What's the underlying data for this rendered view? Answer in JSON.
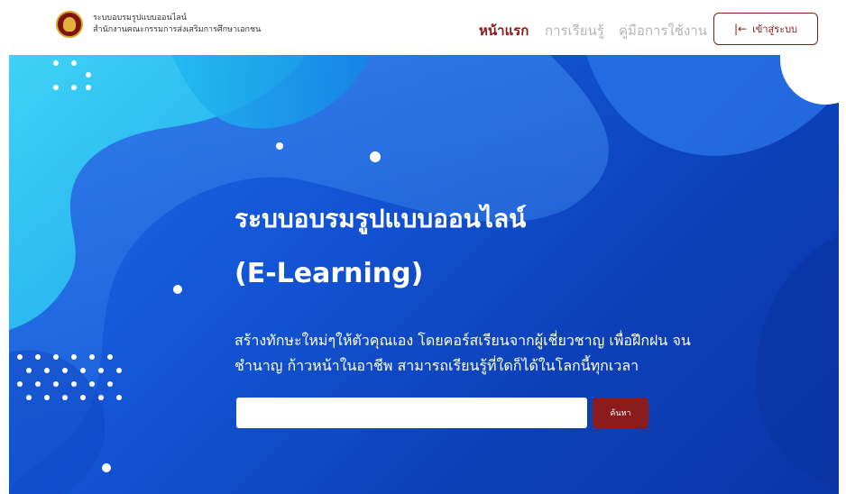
{
  "brand": {
    "title": "ระบบอบรมรูปแบบออนไลน์",
    "subtitle": "สำนักงานคณะกรรมการส่งเสริมการศึกษาเอกชน",
    "logo_icon": "seal-emblem-icon"
  },
  "nav": {
    "home": "หน้าแรก",
    "learn": "การเรียนรู้",
    "manual": "คู่มือการใช้งาน",
    "login_label": "เข้าสู่ระบบ",
    "login_icon": "login-arrow-icon"
  },
  "hero": {
    "title_line1": "ระบบอบรมรูปแบบออนไลน์",
    "title_line2": "(E-Learning)",
    "description": "สร้างทักษะใหม่ๆให้ตัวคุณเอง โดยคอร์สเรียนจากผู้เชี่ยวชาญ เพื่อฝึกฝน จนชำนาญ ก้าวหน้าในอาชีพ สามารถเรียนรู้ที่ใดก็ได้ในโลกนี้ทุกเวลา"
  },
  "search": {
    "value": "",
    "placeholder": "",
    "button_label": "ค้นหา"
  },
  "colors": {
    "brand": "#8b1a1a",
    "nav_inactive": "#b5b5b5",
    "hero_blue": "#1356d6",
    "hero_cyan": "#22c3f0"
  }
}
